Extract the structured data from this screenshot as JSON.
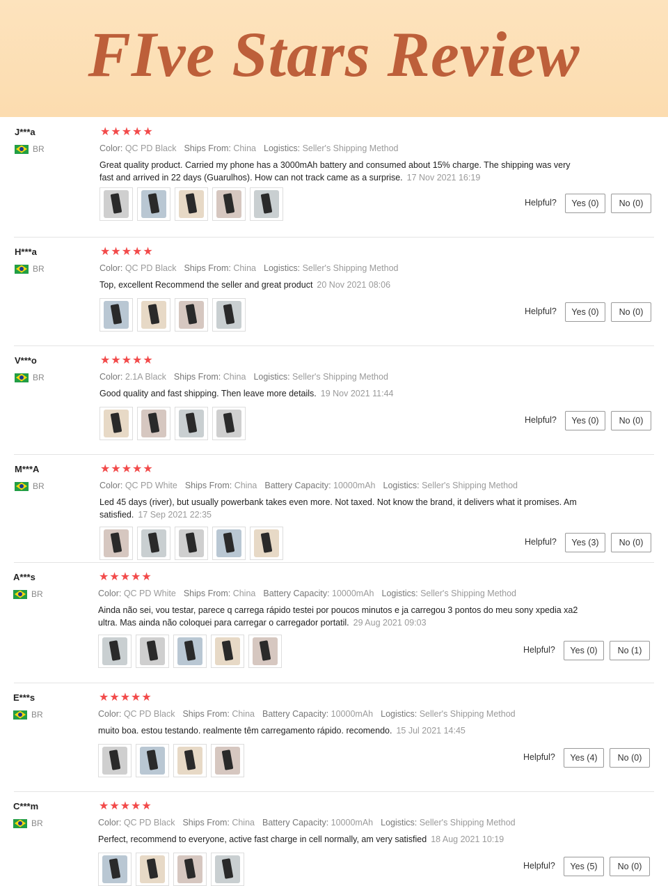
{
  "banner": {
    "title": "FIve Stars Review"
  },
  "reviews": [
    {
      "user": "J***a",
      "country": "BR",
      "stars": "★★★★★",
      "meta": [
        {
          "label": "Color:",
          "value": "QC PD Black"
        },
        {
          "label": "Ships From:",
          "value": "China"
        },
        {
          "label": "Logistics:",
          "value": "Seller's Shipping Method"
        }
      ],
      "text": "Great quality product. Carried my phone has a 3000mAh battery and consumed about 15% charge. The shipping was very fast and arrived in 22 days (Guarulhos). How can not track came as a surprise.",
      "date": "17 Nov 2021 16:19",
      "photos": 5,
      "helpful_label": "Helpful?",
      "yes": "Yes (0)",
      "no": "No (0)"
    },
    {
      "user": "H***a",
      "country": "BR",
      "stars": "★★★★★",
      "meta": [
        {
          "label": "Color:",
          "value": "QC PD Black"
        },
        {
          "label": "Ships From:",
          "value": "China"
        },
        {
          "label": "Logistics:",
          "value": "Seller's Shipping Method"
        }
      ],
      "text": "Top, excellent Recommend the seller and great product",
      "date": "20 Nov 2021 08:06",
      "photos": 4,
      "helpful_label": "Helpful?",
      "yes": "Yes (0)",
      "no": "No (0)"
    },
    {
      "user": "V***o",
      "country": "BR",
      "stars": "★★★★★",
      "meta": [
        {
          "label": "Color:",
          "value": "2.1A Black"
        },
        {
          "label": "Ships From:",
          "value": "China"
        },
        {
          "label": "Logistics:",
          "value": "Seller's Shipping Method"
        }
      ],
      "text": "Good quality and fast shipping. Then leave more details.",
      "date": "19 Nov 2021 11:44",
      "photos": 4,
      "helpful_label": "Helpful?",
      "yes": "Yes (0)",
      "no": "No (0)"
    },
    {
      "user": "M***A",
      "country": "BR",
      "stars": "★★★★★",
      "meta": [
        {
          "label": "Color:",
          "value": "QC PD White"
        },
        {
          "label": "Ships From:",
          "value": "China"
        },
        {
          "label": "Battery Capacity:",
          "value": "10000mAh"
        },
        {
          "label": "Logistics:",
          "value": "Seller's Shipping Method"
        }
      ],
      "text": "Led 45 days (river), but usually powerbank takes even more. Not taxed. Not know the brand, it delivers what it promises. Am satisfied.",
      "date": "17 Sep 2021 22:35",
      "photos": 5,
      "helpful_label": "Helpful?",
      "yes": "Yes (3)",
      "no": "No (0)"
    },
    {
      "user": "A***s",
      "country": "BR",
      "stars": "★★★★★",
      "meta": [
        {
          "label": "Color:",
          "value": "QC PD White"
        },
        {
          "label": "Ships From:",
          "value": "China"
        },
        {
          "label": "Battery Capacity:",
          "value": "10000mAh"
        },
        {
          "label": "Logistics:",
          "value": "Seller's Shipping Method"
        }
      ],
      "text": "Ainda não sei, vou testar, parece q carrega rápido testei por poucos minutos e ja carregou 3 pontos do meu sony xpedia xa2 ultra. Mas ainda não coloquei para carregar o carregador portatil.",
      "date": "29 Aug 2021 09:03",
      "photos": 5,
      "helpful_label": "Helpful?",
      "yes": "Yes (0)",
      "no": "No (1)"
    },
    {
      "user": "E***s",
      "country": "BR",
      "stars": "★★★★★",
      "meta": [
        {
          "label": "Color:",
          "value": "QC PD Black"
        },
        {
          "label": "Ships From:",
          "value": "China"
        },
        {
          "label": "Battery Capacity:",
          "value": "10000mAh"
        },
        {
          "label": "Logistics:",
          "value": "Seller's Shipping Method"
        }
      ],
      "text": "muito boa. estou testando. realmente têm carregamento rápido. recomendo.",
      "date": "15 Jul 2021 14:45",
      "photos": 4,
      "helpful_label": "Helpful?",
      "yes": "Yes (4)",
      "no": "No (0)"
    },
    {
      "user": "C***m",
      "country": "BR",
      "stars": "★★★★★",
      "meta": [
        {
          "label": "Color:",
          "value": "QC PD Black"
        },
        {
          "label": "Ships From:",
          "value": "China"
        },
        {
          "label": "Battery Capacity:",
          "value": "10000mAh"
        },
        {
          "label": "Logistics:",
          "value": "Seller's Shipping Method"
        }
      ],
      "text": "Perfect, recommend to everyone, active fast charge in cell normally, am very satisfied",
      "date": "18 Aug 2021 10:19",
      "photos": 4,
      "helpful_label": "Helpful?",
      "yes": "Yes (5)",
      "no": "No (0)"
    }
  ]
}
